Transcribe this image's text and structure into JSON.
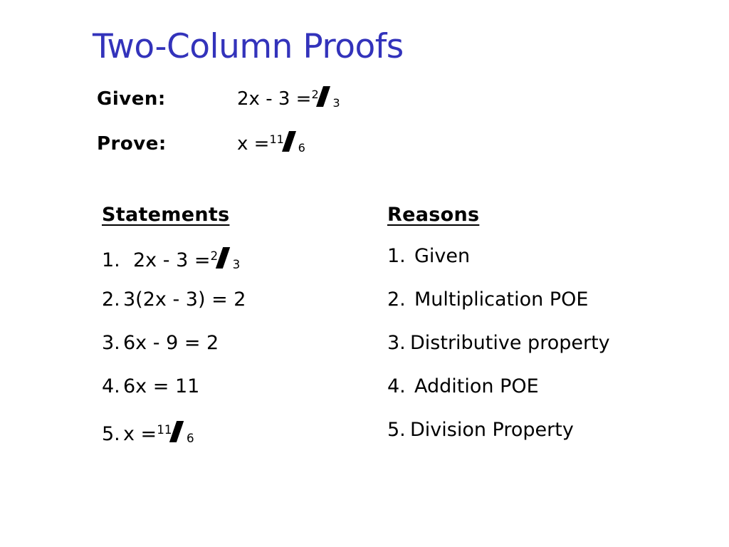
{
  "slide": {
    "title": "Two-Column Proofs",
    "title_color": "#3333bb",
    "background_color": "#ffffff",
    "text_color": "#000000"
  },
  "premise": {
    "given": {
      "label": "Given:",
      "expr_prefix": "2x - 3 = ",
      "fraction": {
        "numerator": "2",
        "denominator": "3"
      }
    },
    "prove": {
      "label": "Prove:",
      "expr_prefix": "x = ",
      "fraction": {
        "numerator": "11",
        "denominator": "6"
      }
    }
  },
  "proof": {
    "headers": {
      "statements": "Statements",
      "reasons": "Reasons"
    },
    "statements": [
      {
        "number": "1.",
        "prefix": "2x - 3 = ",
        "fraction": {
          "numerator": "2",
          "denominator": "3"
        }
      },
      {
        "number": "2.",
        "prefix": "3(2x - 3) = 2",
        "fraction": null
      },
      {
        "number": "3.",
        "prefix": "6x - 9 = 2",
        "fraction": null
      },
      {
        "number": "4.",
        "prefix": "6x = 11",
        "fraction": null
      },
      {
        "number": "5.",
        "prefix": "x = ",
        "fraction": {
          "numerator": "11",
          "denominator": "6"
        }
      }
    ],
    "reasons": [
      {
        "number": "1.",
        "text": "Given"
      },
      {
        "number": "2.",
        "text": "Multiplication POE"
      },
      {
        "number": "3.",
        "text": "Distributive property"
      },
      {
        "number": "4.",
        "text": "Addition POE"
      },
      {
        "number": "5.",
        "text": "Division Property"
      }
    ]
  }
}
